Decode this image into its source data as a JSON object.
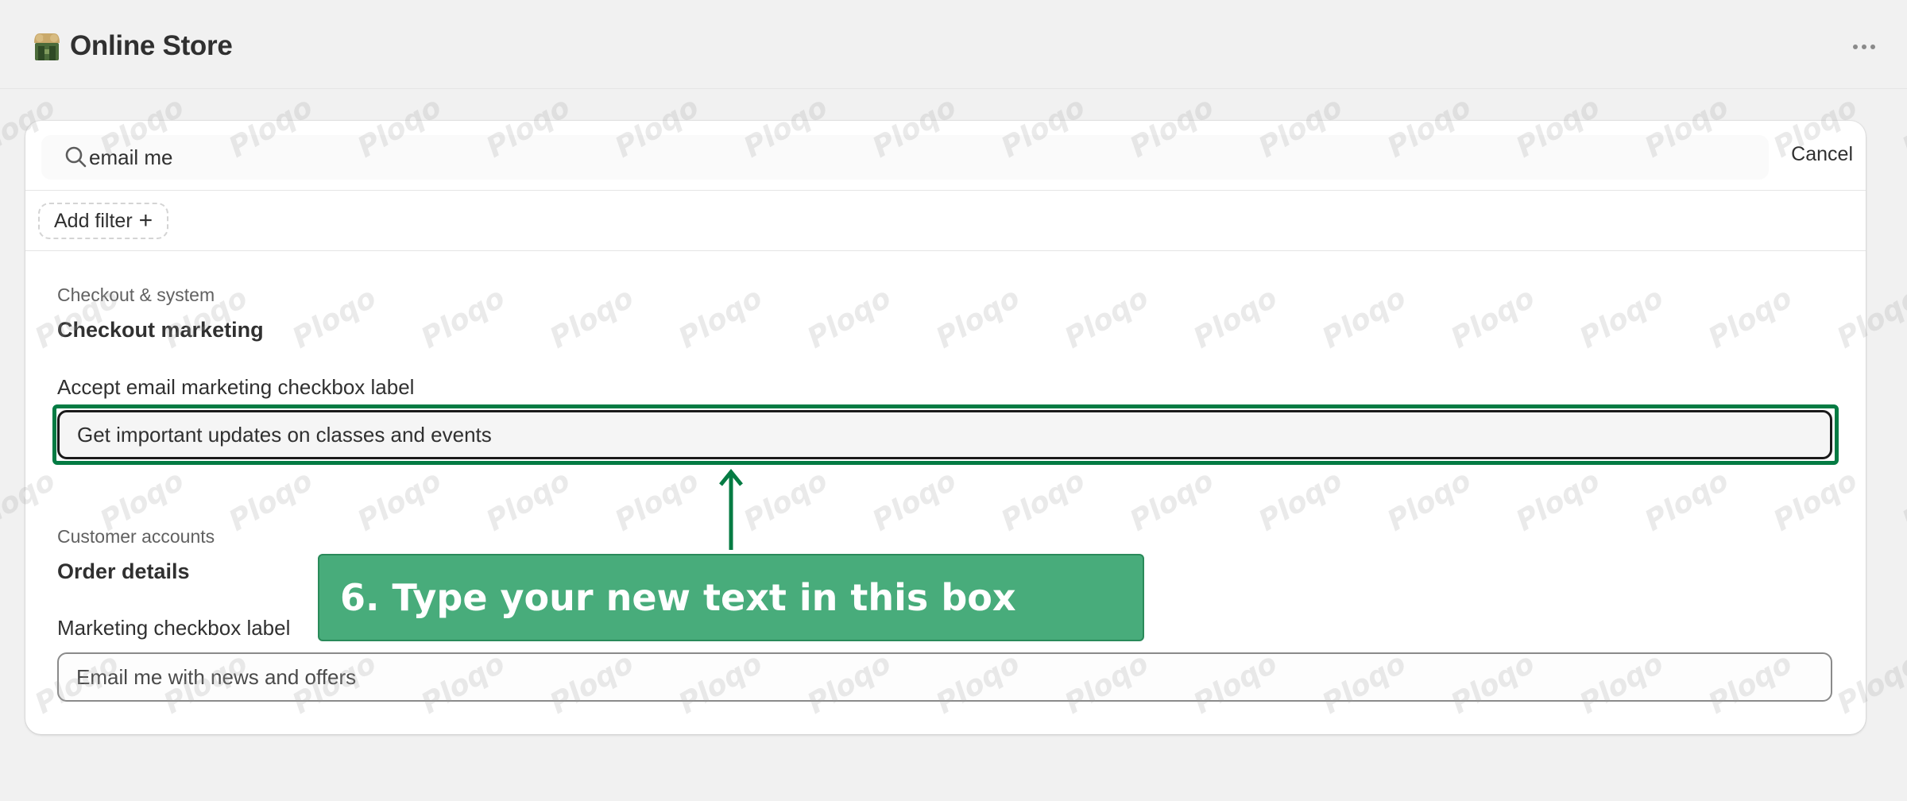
{
  "header": {
    "title": "Online Store",
    "store_icon": "store-icon",
    "more_icon": "more-horizontal-icon"
  },
  "search": {
    "value": "email me",
    "icon": "search-icon",
    "cancel_label": "Cancel"
  },
  "filter": {
    "add_label": "Add filter",
    "plus": "+"
  },
  "sections": [
    {
      "category": "Checkout & system",
      "title": "Checkout marketing",
      "field_label": "Accept email marketing checkbox label",
      "field_value": "Get important updates on classes and events"
    },
    {
      "category": "Customer accounts",
      "title": "Order details",
      "field_label": "Marketing checkbox label",
      "field_value": "Email me with news and offers"
    }
  ],
  "callout": {
    "text": "6. Type your new text in this box",
    "color": "#48ac7b",
    "highlight_color": "#047b43"
  },
  "watermark": "Ploqo"
}
